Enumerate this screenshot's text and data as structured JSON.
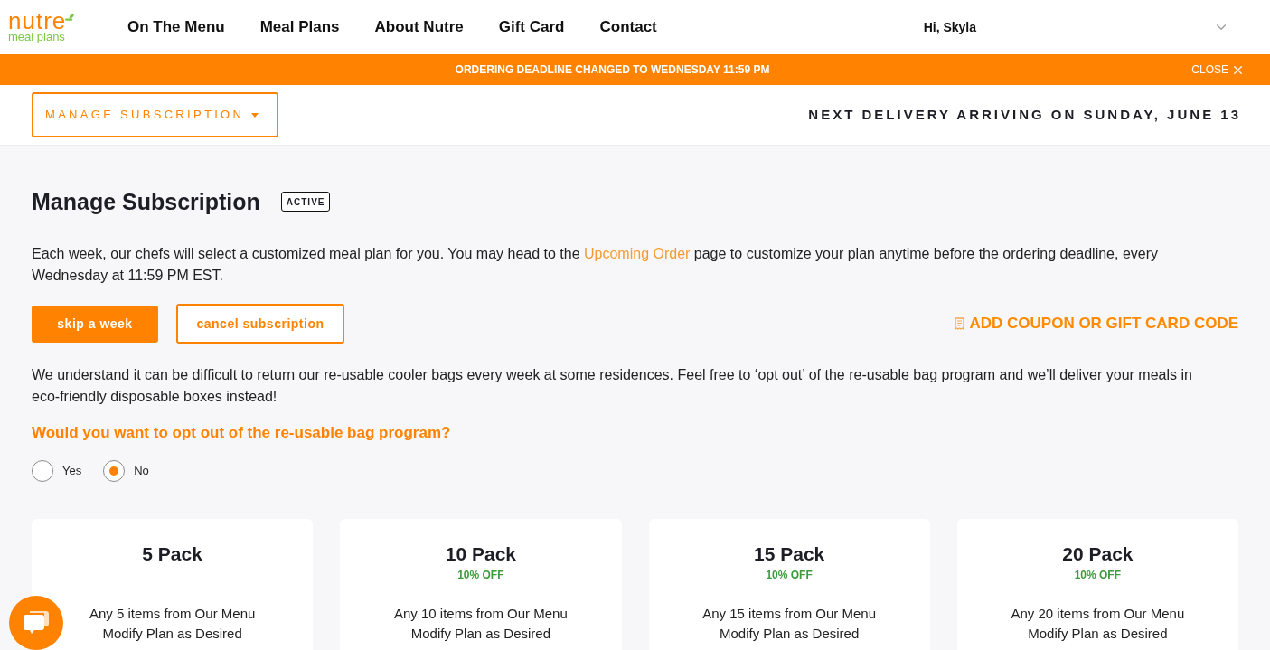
{
  "header": {
    "logo": {
      "wordmark": "nutre",
      "tagline": "meal plans"
    },
    "nav": [
      "On The Menu",
      "Meal Plans",
      "About Nutre",
      "Gift Card",
      "Contact"
    ],
    "greeting": "Hi, Skyla"
  },
  "banner": {
    "message": "ORDERING DEADLINE CHANGED TO WEDNESDAY 11:59 PM",
    "close": "CLOSE"
  },
  "subheader": {
    "dropdown": "MANAGE SUBSCRIPTION",
    "delivery": "NEXT DELIVERY ARRIVING ON SUNDAY, JUNE 13"
  },
  "subscription": {
    "title": "Manage Subscription",
    "status": "ACTIVE",
    "intro": {
      "before": "Each week, our chefs will select a customized meal plan for you. You may head to the ",
      "link": "Upcoming Order",
      "after": " page to customize your plan anytime before the ordering deadline, every Wednesday at 11:59 PM EST."
    },
    "actions": [
      {
        "label": "skip a week",
        "kind": "primary"
      },
      {
        "label": "cancel subscription",
        "kind": "outline"
      }
    ],
    "coupon_link": "ADD COUPON OR GIFT CARD CODE",
    "bag_note": "We understand it can be difficult to return our re-usable cooler bags every week at some residences. Feel free to ‘opt out’ of the re-usable bag program and we’ll deliver your meals in eco-friendly disposable boxes instead!",
    "question": "Would you want to opt out of the re-usable bag program?",
    "options": [
      {
        "label": "Yes",
        "selected": false
      },
      {
        "label": "No",
        "selected": true
      }
    ]
  },
  "plans": [
    {
      "title": "5 Pack",
      "lines": [
        "Any 5 items from Our Menu",
        "Modify Plan as Desired"
      ]
    },
    {
      "title": "10 Pack",
      "discount": "10% OFF",
      "lines": [
        "Any 10 items from Our Menu",
        "Modify Plan as Desired"
      ]
    },
    {
      "title": "15 Pack",
      "discount": "10% OFF",
      "lines": [
        "Any 15 items from Our Menu",
        "Modify Plan as Desired"
      ]
    },
    {
      "title": "20 Pack",
      "discount": "10% OFF",
      "lines": [
        "Any 20 items from Our Menu",
        "Modify Plan as Desired"
      ]
    }
  ]
}
